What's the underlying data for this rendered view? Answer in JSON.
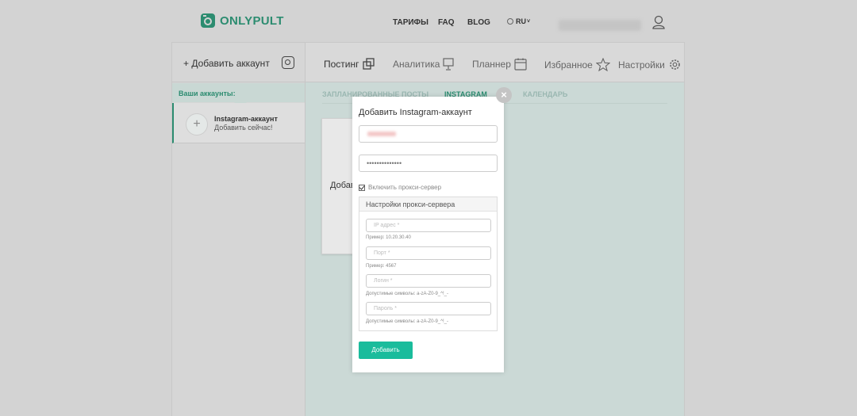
{
  "header": {
    "logo_text": "ONLYPULT",
    "nav": [
      "ТАРИФЫ",
      "FAQ",
      "BLOG"
    ],
    "lang": "RU"
  },
  "sidebar": {
    "add_account_label": "+ Добавить аккаунт",
    "accounts_label": "Ваши аккаунты:",
    "account": {
      "name": "Instagram-аккаунт",
      "sub": "Добавить сейчас!"
    }
  },
  "tabs": [
    "Постинг",
    "Аналитика",
    "Планнер",
    "Избранное",
    "Настройки"
  ],
  "subtabs": [
    "ЗАПЛАНИРОВАННЫЕ ПОСТЫ",
    "INSTAGRAM",
    "КАЛЕНДАРЬ"
  ],
  "card_text": "Добав",
  "modal": {
    "title": "Добавить Instagram-аккаунт",
    "password_value": "••••••••••••••",
    "proxy_checkbox_label": "Включить прокси-сервер",
    "proxy_header": "Настройки прокси-сервера",
    "ip_placeholder": "IP адрес *",
    "ip_hint": "Пример: 10.20.30.40",
    "port_placeholder": "Порт *",
    "port_hint": "Пример: 4567",
    "login_placeholder": "Логин *",
    "login_hint": "Допустимые символы: a-zA-Z0-9_^!_-",
    "pass_placeholder": "Пароль *",
    "pass_hint": "Допустимые символы: a-zA-Z0-9_^!_-",
    "submit_label": "Добавить",
    "close_glyph": "×"
  },
  "colors": {
    "brand": "#2c8c70",
    "button": "#1abc9c"
  }
}
